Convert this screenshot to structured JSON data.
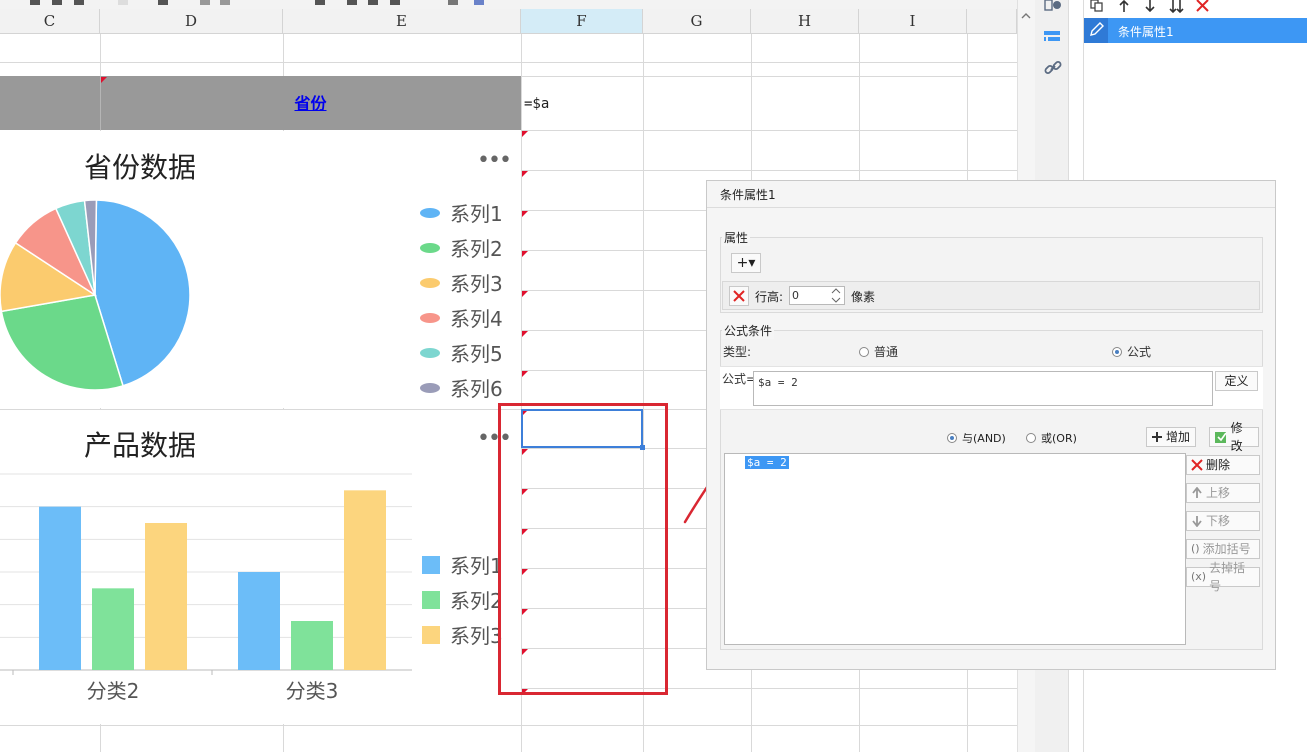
{
  "columns": [
    "C",
    "D",
    "E",
    "F",
    "G",
    "H",
    "I"
  ],
  "active_column": "F",
  "header_cell": {
    "label": "省份"
  },
  "formula_cell": "=$a",
  "pie_chart": {
    "title": "省份数据",
    "more": "•••",
    "legend": [
      {
        "label": "系列1",
        "color": "#5fb4f5"
      },
      {
        "label": "系列2",
        "color": "#6bd98a"
      },
      {
        "label": "系列3",
        "color": "#fbcb6e"
      },
      {
        "label": "系列4",
        "color": "#f7958a"
      },
      {
        "label": "系列5",
        "color": "#7dd6d0"
      },
      {
        "label": "系列6",
        "color": "#9a9cb8"
      }
    ],
    "slices": [
      45,
      27,
      12,
      9,
      5,
      2
    ]
  },
  "bar_chart": {
    "title": "产品数据",
    "more": "•••",
    "categories": [
      "分类2",
      "分类3"
    ],
    "series": [
      {
        "name": "系列1",
        "color": "#6cbdf8",
        "values": [
          5.0,
          3.0
        ]
      },
      {
        "name": "系列2",
        "color": "#7fe29a",
        "values": [
          2.5,
          1.5
        ]
      },
      {
        "name": "系列3",
        "color": "#fcd57e",
        "values": [
          4.5,
          5.5
        ]
      }
    ],
    "ylim": [
      0,
      6
    ]
  },
  "right_panel": {
    "selected_item": "条件属性1"
  },
  "dialog": {
    "title": "条件属性1",
    "attr_group": "属性",
    "add_symbol": "+▾",
    "row_height_label": "行高:",
    "row_height_value": "0",
    "unit": "像素",
    "formula_group": "公式条件",
    "type_label": "类型:",
    "type_normal": "普通",
    "type_formula": "公式",
    "formula_label": "公式=",
    "formula_value": "$a = 2",
    "define_btn": "定义",
    "and_label": "与(AND)",
    "or_label": "或(OR)",
    "add_btn": "增加",
    "modify_btn": "修改",
    "list_items": [
      "$a = 2"
    ],
    "delete_btn": "删除",
    "move_up_btn": "上移",
    "move_down_btn": "下移",
    "add_paren_btn": "添加括号",
    "remove_paren_btn": "去掉括号"
  }
}
